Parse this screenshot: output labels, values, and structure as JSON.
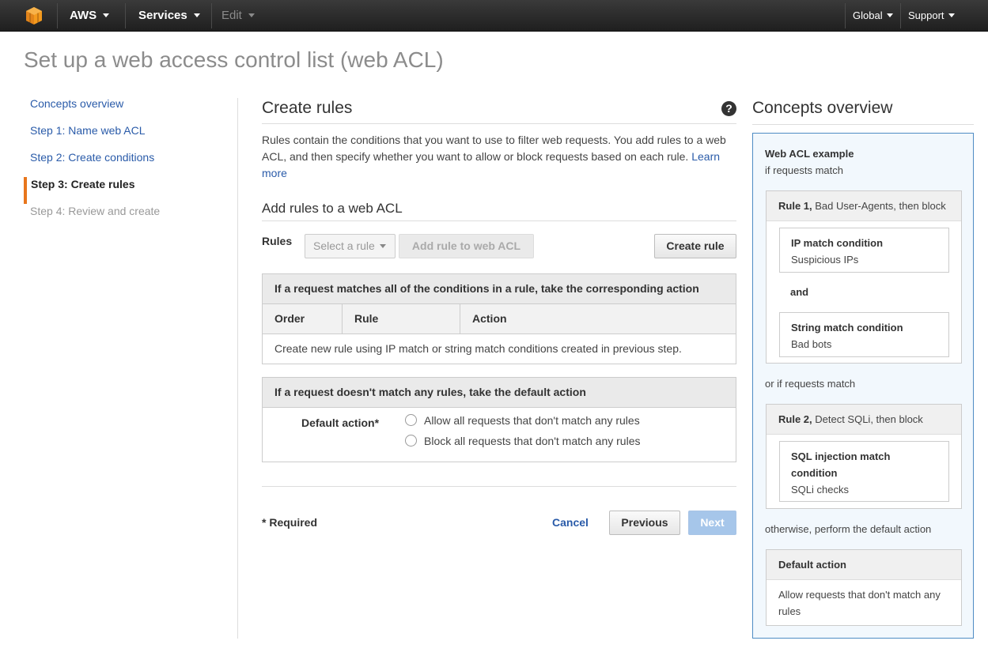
{
  "topnav": {
    "logo_icon": "aws-cube-icon",
    "aws_label": "AWS",
    "services_label": "Services",
    "edit_label": "Edit",
    "global_label": "Global",
    "support_label": "Support"
  },
  "page_title": "Set up a web access control list (web ACL)",
  "steps": [
    {
      "label": "Concepts overview",
      "state": "link"
    },
    {
      "label": "Step 1: Name web ACL",
      "state": "link"
    },
    {
      "label": "Step 2: Create conditions",
      "state": "link"
    },
    {
      "label": "Step 3: Create rules",
      "state": "active"
    },
    {
      "label": "Step 4: Review and create",
      "state": "disabled"
    }
  ],
  "main": {
    "title": "Create rules",
    "help_icon": "?",
    "description": "Rules contain the conditions that you want to use to filter web requests. You add rules to a web ACL, and then specify whether you want to allow or block requests based on each rule.",
    "learn_more": "Learn more",
    "add_rules_heading": "Add rules to a web ACL",
    "rules_label": "Rules",
    "select_rule_placeholder": "Select a rule",
    "add_rule_button": "Add rule to web ACL",
    "create_rule_button": "Create rule",
    "match_panel": {
      "heading": "If a request matches all of the conditions in a rule, take the corresponding action",
      "columns": [
        "Order",
        "Rule",
        "Action"
      ],
      "empty_message": "Create new rule using IP match or string match conditions created in previous step."
    },
    "default_panel": {
      "heading": "If a request doesn't match any rules, take the default action",
      "default_action_label": "Default action*",
      "options": [
        "Allow all requests that don't match any rules",
        "Block all requests that don't match any rules"
      ]
    },
    "required_note": "* Required",
    "cancel_label": "Cancel",
    "previous_label": "Previous",
    "next_label": "Next"
  },
  "concepts": {
    "title": "Concepts overview",
    "example_title": "Web ACL example",
    "if_match": "if requests match",
    "rule1_bold": "Rule 1,",
    "rule1_text": " Bad User-Agents, then block",
    "cond1_title": "IP match condition",
    "cond1_value": "Suspicious IPs",
    "and_label": "and",
    "cond2_title": "String match condition",
    "cond2_value": "Bad bots",
    "or_if_match": "or if requests match",
    "rule2_bold": "Rule 2,",
    "rule2_text": " Detect SQLi, then block",
    "cond3_title_line1": "SQL injection match",
    "cond3_title_line2": "condition",
    "cond3_value": "SQLi checks",
    "otherwise": "otherwise, perform the default action",
    "default_action_title": "Default action",
    "default_action_text_line1": "Allow requests that don't match any",
    "default_action_text_line2": "rules"
  },
  "colors": {
    "nav_bg": "#232323",
    "link": "#2a5ba9",
    "active_step_accent": "#e8761c",
    "concepts_bg": "#f2f8fd",
    "concepts_border": "#4e8cc4",
    "next_button": "#a6c6ea"
  }
}
